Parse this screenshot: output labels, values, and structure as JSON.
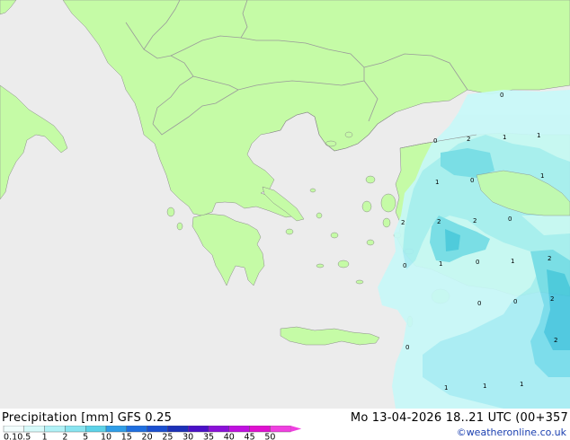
{
  "colors": {
    "sea": "#ececec",
    "land": "#c5fba6",
    "border": "#9a9a9a",
    "coast": "#8a8a8a",
    "precip_light": "#c8f8f8",
    "precip_1": "#a6eef4",
    "precip_2": "#74dceb",
    "precip_3": "#45c7e0",
    "credit": "#1a3fb0"
  },
  "map": {
    "values": [
      "0",
      "2",
      "1",
      "1",
      "1",
      "0",
      "1",
      "0",
      "2",
      "2",
      "2",
      "0",
      "0",
      "1",
      "2",
      "1",
      "0",
      "0",
      "2",
      "0",
      "2",
      "1",
      "1",
      "1",
      "0"
    ]
  },
  "footer": {
    "title_left": "Precipitation [mm]  GFS 0.25",
    "title_right": "Mo 13-04-2026 18..21 UTC (00+357",
    "credit": "©weatheronline.co.uk"
  },
  "legend": {
    "ticks": [
      "0.1",
      "0.5",
      "1",
      "2",
      "5",
      "10",
      "15",
      "20",
      "25",
      "30",
      "35",
      "40",
      "45",
      "50"
    ],
    "colors": [
      "#f2fdfd",
      "#d6fafa",
      "#b0f1f6",
      "#88e4f0",
      "#5cd2e8",
      "#2f9ee8",
      "#1f6fe0",
      "#1a4fd0",
      "#1c30b8",
      "#4a10c8",
      "#8a10d8",
      "#c010e0",
      "#e010d0",
      "#f040e0"
    ]
  }
}
